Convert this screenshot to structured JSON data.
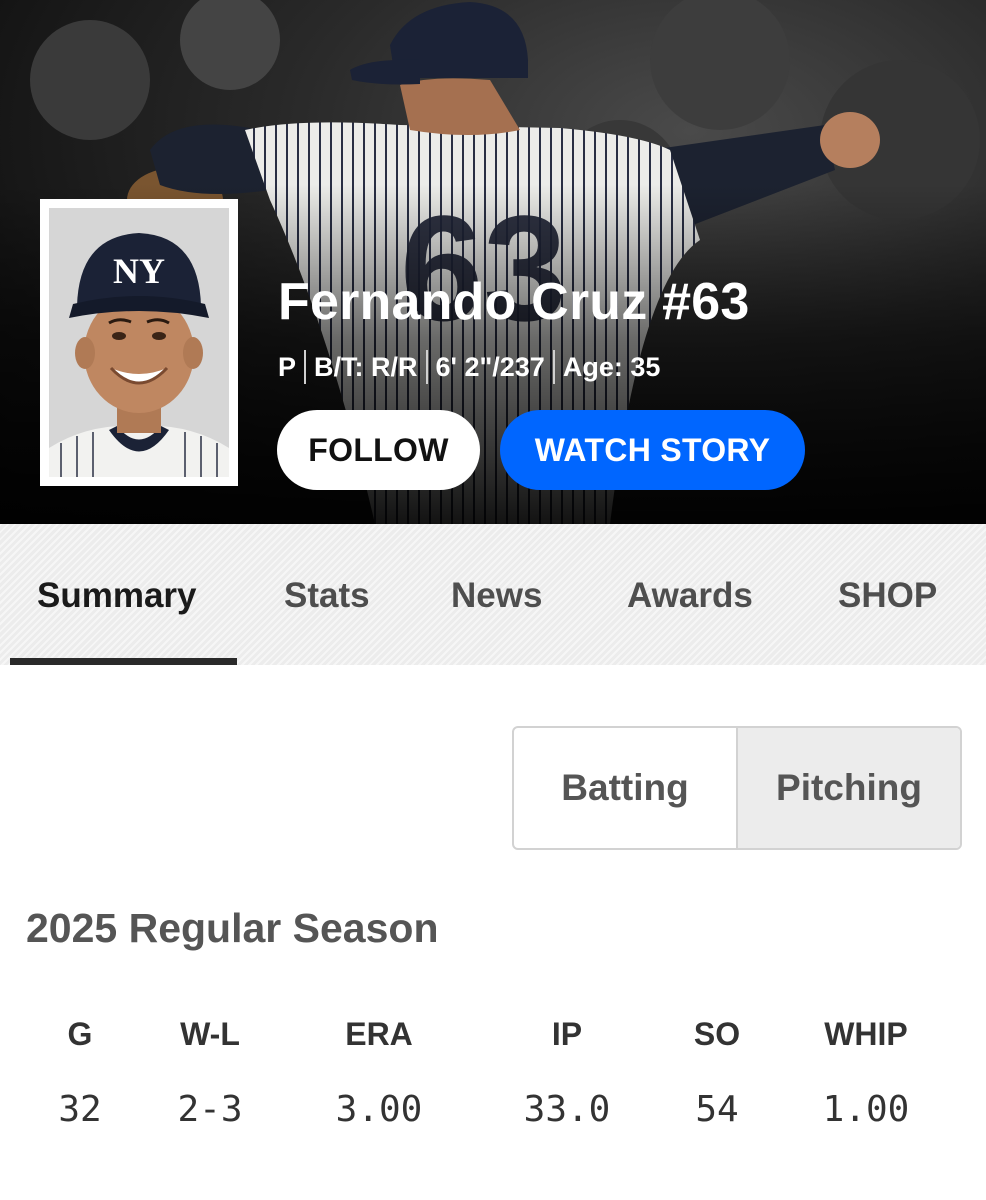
{
  "player": {
    "name": "Fernando Cruz #63",
    "position": "P",
    "bats_throws": "B/T: R/R",
    "height_weight": "6' 2\"/237",
    "age": "Age: 35",
    "jersey_number": "63",
    "cap_logo": "NY"
  },
  "actions": {
    "follow_label": "FOLLOW",
    "watch_story_label": "WATCH STORY"
  },
  "tabs": [
    {
      "label": "Summary",
      "active": true
    },
    {
      "label": "Stats",
      "active": false
    },
    {
      "label": "News",
      "active": false
    },
    {
      "label": "Awards",
      "active": false
    },
    {
      "label": "SHOP",
      "active": false
    }
  ],
  "toggle": {
    "batting_label": "Batting",
    "pitching_label": "Pitching",
    "selected": "Pitching"
  },
  "season": {
    "title": "2025 Regular Season",
    "columns": [
      {
        "label": "G",
        "value": "32"
      },
      {
        "label": "W-L",
        "value": "2-3"
      },
      {
        "label": "ERA",
        "value": "3.00"
      },
      {
        "label": "IP",
        "value": "33.0"
      },
      {
        "label": "SO",
        "value": "54"
      },
      {
        "label": "WHIP",
        "value": "1.00"
      }
    ]
  },
  "colors": {
    "accent_blue": "#0066ff",
    "tab_underline": "#2a2a2a",
    "team_navy": "#1b2236"
  },
  "icons": {
    "hero": "pitcher-photo",
    "headshot": "player-headshot"
  }
}
